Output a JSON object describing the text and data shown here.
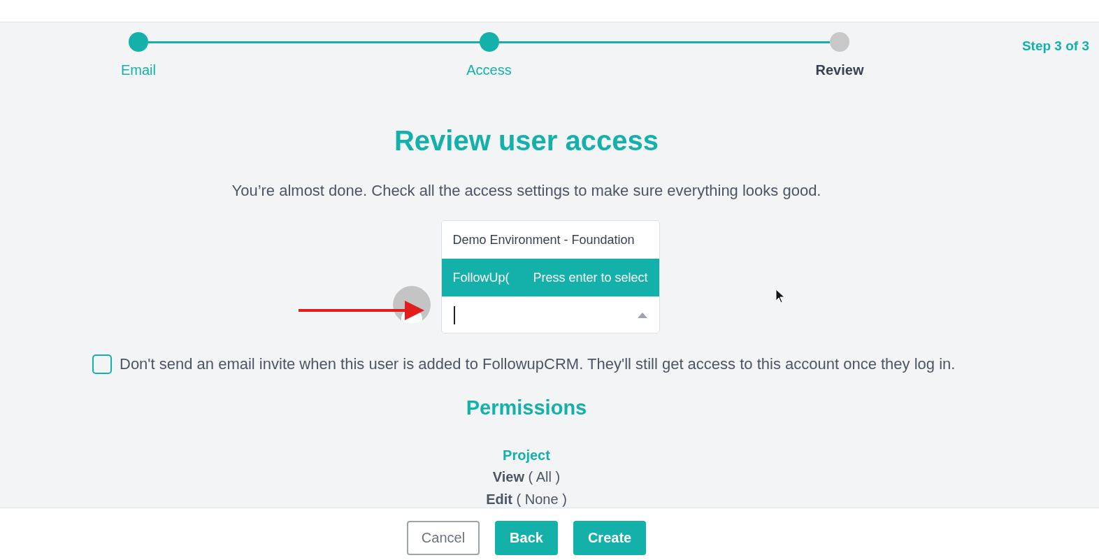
{
  "steps": [
    {
      "label": "Email",
      "completed": true,
      "selected": false
    },
    {
      "label": "Access",
      "completed": true,
      "selected": false
    },
    {
      "label": "Review",
      "completed": false,
      "selected": true
    }
  ],
  "step_counter": "Step 3 of 3",
  "title": "Review user access",
  "subtitle": "You’re almost done. Check all the access settings to make sure everything looks good.",
  "account_select": {
    "options": [
      {
        "label": "Demo Environment - Foundation",
        "selected": false
      },
      {
        "label": "FollowUp(",
        "hint": "Press enter to select",
        "selected": true
      }
    ]
  },
  "no_invite": {
    "label": "Don't send an email invite when this user is added to FollowupCRM. They'll still get access to this account once they log in.",
    "checked": false
  },
  "permissions": {
    "title": "Permissions",
    "groups": [
      {
        "name": "Project",
        "rights": [
          {
            "action": "View",
            "scope": "( All )"
          },
          {
            "action": "Edit",
            "scope": "( None )"
          }
        ]
      }
    ]
  },
  "buttons": [
    {
      "label": "Cancel",
      "kind": "secondary"
    },
    {
      "label": "Back",
      "kind": "primary"
    },
    {
      "label": "Create",
      "kind": "primary"
    }
  ]
}
